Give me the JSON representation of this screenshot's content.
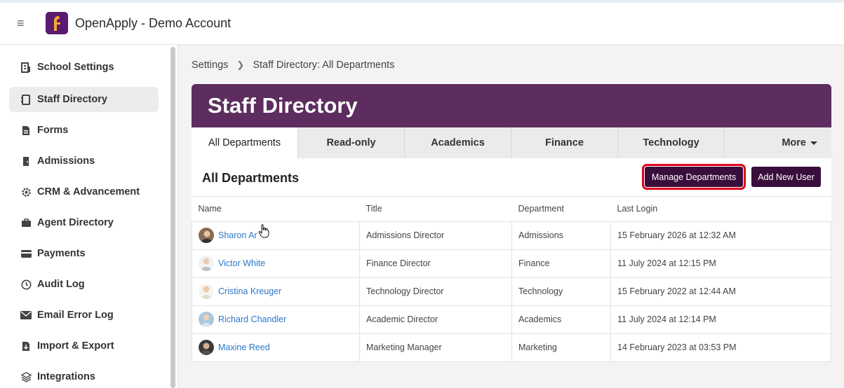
{
  "app": {
    "title": "OpenApply - Demo Account"
  },
  "sidebar": {
    "items": [
      {
        "label": "School Settings",
        "icon": "building-icon"
      },
      {
        "label": "Staff Directory",
        "icon": "directory-icon",
        "active": true
      },
      {
        "label": "Forms",
        "icon": "document-icon"
      },
      {
        "label": "Admissions",
        "icon": "door-icon"
      },
      {
        "label": "CRM & Advancement",
        "icon": "gear-icon"
      },
      {
        "label": "Agent Directory",
        "icon": "briefcase-icon"
      },
      {
        "label": "Payments",
        "icon": "card-icon"
      },
      {
        "label": "Audit Log",
        "icon": "clock-icon"
      },
      {
        "label": "Email Error Log",
        "icon": "mail-error-icon"
      },
      {
        "label": "Import & Export",
        "icon": "import-icon"
      },
      {
        "label": "Integrations",
        "icon": "layers-icon"
      }
    ]
  },
  "breadcrumb": {
    "parent": "Settings",
    "current": "Staff Directory: All Departments"
  },
  "card": {
    "title": "Staff Directory",
    "tabs": [
      "All Departments",
      "Read-only",
      "Academics",
      "Finance",
      "Technology"
    ],
    "more_label": "More",
    "section_title": "All Departments",
    "manage_label": "Manage Departments",
    "add_label": "Add New User"
  },
  "table": {
    "headers": [
      "Name",
      "Title",
      "Department",
      "Last Login"
    ],
    "rows": [
      {
        "name": "Sharon Ar",
        "title": "Admissions Director",
        "department": "Admissions",
        "last_login": "15 February 2026 at 12:32 AM"
      },
      {
        "name": "Victor White",
        "title": "Finance Director",
        "department": "Finance",
        "last_login": "11 July 2024 at 12:15 PM"
      },
      {
        "name": "Cristina Kreuger",
        "title": "Technology Director",
        "department": "Technology",
        "last_login": "15 February 2022 at 12:44 AM"
      },
      {
        "name": "Richard Chandler",
        "title": "Academic Director",
        "department": "Academics",
        "last_login": "11 July 2024 at 12:14 PM"
      },
      {
        "name": "Maxine Reed",
        "title": "Marketing Manager",
        "department": "Marketing",
        "last_login": "14 February 2023 at 03:53 PM"
      }
    ]
  },
  "colors": {
    "brand": "#5c2d5e",
    "button": "#3a0e3b",
    "link": "#2c77c9",
    "highlight": "#e0001a"
  }
}
